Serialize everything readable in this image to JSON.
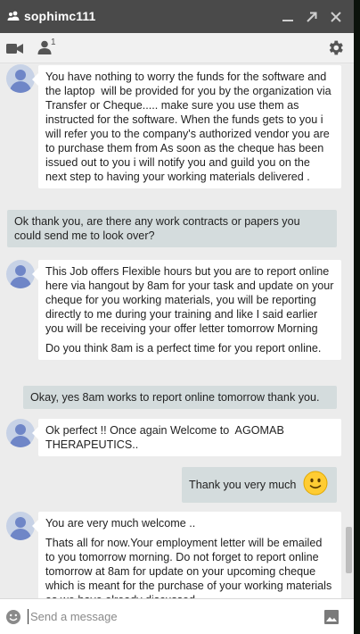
{
  "window": {
    "title": "sophimc111",
    "participant_count": "1"
  },
  "composer": {
    "placeholder": "Send a message"
  },
  "messages": [
    {
      "from": "contact",
      "paragraphs": [
        "You have nothing to worry the funds for the software and the laptop  will be provided for you by the organization via Transfer or Cheque..... make sure you use them as instructed for the software. When the funds gets to you i will refer you to the company's authorized vendor you are to purchase them from As soon as the cheque has been issued out to you i will notify you and guild you on the next step to having your working materials delivered ."
      ]
    },
    {
      "from": "me",
      "paragraphs": [
        "Ok thank you, are there any work contracts or papers you could send me to look over?"
      ]
    },
    {
      "from": "contact",
      "paragraphs": [
        "This Job offers Flexible hours but you are to report online here via hangout by 8am for your task and update on your cheque for you working materials, you will be reporting directly to me during your training and like I said earlier you will be receiving your offer letter tomorrow Morning",
        "Do you think 8am is a perfect time for you report online."
      ]
    },
    {
      "from": "me",
      "paragraphs": [
        "Okay, yes 8am works to report online tomorrow thank you."
      ]
    },
    {
      "from": "contact",
      "paragraphs": [
        "Ok perfect !! Once again Welcome to  AGOMAB THERAPEUTICS.."
      ]
    },
    {
      "from": "me",
      "paragraphs": [
        "Thank you very much"
      ],
      "emoji": "slightly-smiling-face-icon"
    },
    {
      "from": "contact",
      "paragraphs": [
        "You are very much welcome ..",
        "Thats all for now.Your employment letter will be emailed to you tomorrow morning. Do not forget to report online tomorrow at 8am for update on your upcoming cheque which is meant for the purchase of your working materials as we have already discussed."
      ]
    }
  ],
  "colors": {
    "titlebar": "#4a4a4a",
    "toolbar": "#f1f1f1",
    "chat_background": "#ececec",
    "incoming_bubble": "#ffffff",
    "outgoing_bubble": "#d4dcdd",
    "avatar_figure": "#6f86c7",
    "avatar_background": "#c7d2e6"
  }
}
